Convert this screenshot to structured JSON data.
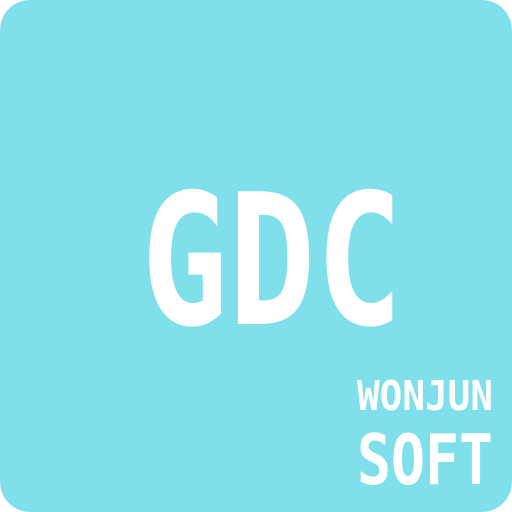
{
  "icon": {
    "background_color": "#7fdfea",
    "foreground_color": "#ffffff",
    "main_text": "GDC",
    "brand_line1": "WONJUN",
    "brand_line2": "SOFT"
  }
}
